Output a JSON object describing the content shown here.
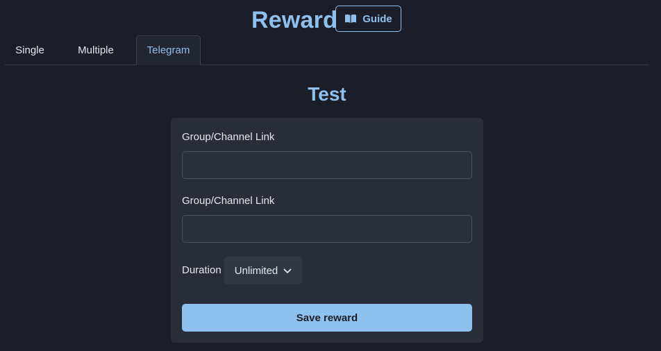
{
  "header": {
    "title": "Reward",
    "guide_label": "Guide",
    "guide_icon": "book-open-icon"
  },
  "tabs": [
    {
      "label": "Single",
      "active": false
    },
    {
      "label": "Multiple",
      "active": false
    },
    {
      "label": "Telegram",
      "active": true
    }
  ],
  "section": {
    "title": "Test"
  },
  "form": {
    "field1": {
      "label": "Group/Channel Link",
      "value": "",
      "placeholder": ""
    },
    "field2": {
      "label": "Group/Channel Link",
      "value": "",
      "placeholder": ""
    },
    "duration": {
      "label": "Duration",
      "selected": "Unlimited",
      "icon": "chevron-down-icon"
    },
    "save_label": "Save reward"
  },
  "colors": {
    "background": "#1b1e28",
    "accent": "#8fbfed",
    "card": "#282d39",
    "button": "#8fc1ee"
  }
}
